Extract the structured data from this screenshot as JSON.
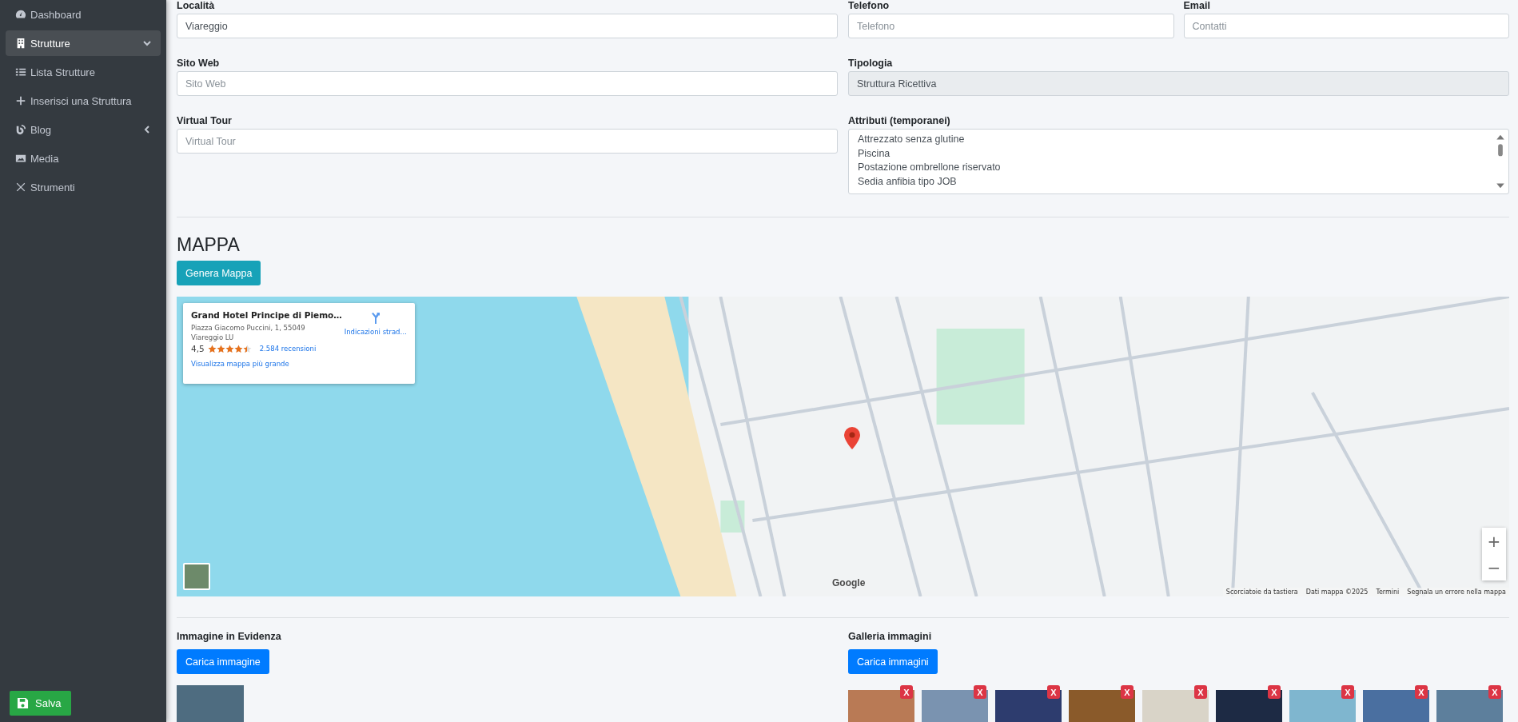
{
  "sidebar": {
    "items": [
      {
        "label": "Dashboard",
        "selected": false
      },
      {
        "label": "Strutture",
        "selected": true,
        "expanded": true,
        "children": [
          {
            "label": "Lista Strutture",
            "selected": false
          },
          {
            "label": "Inserisci una Struttura",
            "selected": false
          }
        ]
      },
      {
        "label": "Blog",
        "selected": false,
        "expanded": false
      },
      {
        "label": "Media",
        "selected": false
      },
      {
        "label": "Strumenti",
        "selected": false
      }
    ]
  },
  "save_button": "Salva",
  "fields_left": [
    {
      "label": "Località",
      "value": "Viareggio"
    },
    {
      "label": "Sito Web",
      "placeholder": "Sito Web"
    },
    {
      "label": "Virtual Tour",
      "placeholder": "Virtual Tour"
    }
  ],
  "contact_fields": [
    {
      "label": "Telefono",
      "placeholder": "Telefono"
    },
    {
      "label": "Email",
      "placeholder": "Contatti"
    }
  ],
  "tipologia": {
    "label": "Tipologia",
    "value": "Struttura Ricettiva",
    "disabled": true
  },
  "attributes": {
    "label": "Attributi (temporanei)",
    "options": [
      "Attrezzato senza glutine",
      "Piscina",
      "Postazione ombrellone riservato",
      "Sedia anfibia tipo JOB"
    ]
  },
  "map": {
    "title": "MAPPA",
    "generate_button": "Genera Mappa",
    "place_card": {
      "name": "Grand Hotel Principe di Piemo…",
      "address_lines": [
        "Piazza Giacomo Puccini, 1, 55049",
        "Viareggio LU"
      ],
      "rating": "4,5",
      "stars": 4.5,
      "reviews": "2.584 recensioni",
      "directions": "Indicazioni strad…",
      "larger_map": "Visualizza mappa più grande"
    },
    "zoom_in": "+",
    "zoom_out": "−",
    "logo": "Google",
    "footer_links": [
      "Scorciatoie da tastiera",
      "Dati mappa ©2025",
      "Termini",
      "Segnala un errore nella mappa"
    ]
  },
  "featured": {
    "label": "Immagine in Evidenza",
    "button": "Carica immagine"
  },
  "gallery": {
    "label": "Galleria immagini",
    "button": "Carica immagini",
    "images": [
      {
        "remove": "X"
      },
      {
        "remove": "X"
      },
      {
        "remove": "X"
      },
      {
        "remove": "X"
      },
      {
        "remove": "X"
      },
      {
        "remove": "X"
      },
      {
        "remove": "X"
      },
      {
        "remove": "X"
      },
      {
        "remove": "X"
      }
    ]
  }
}
